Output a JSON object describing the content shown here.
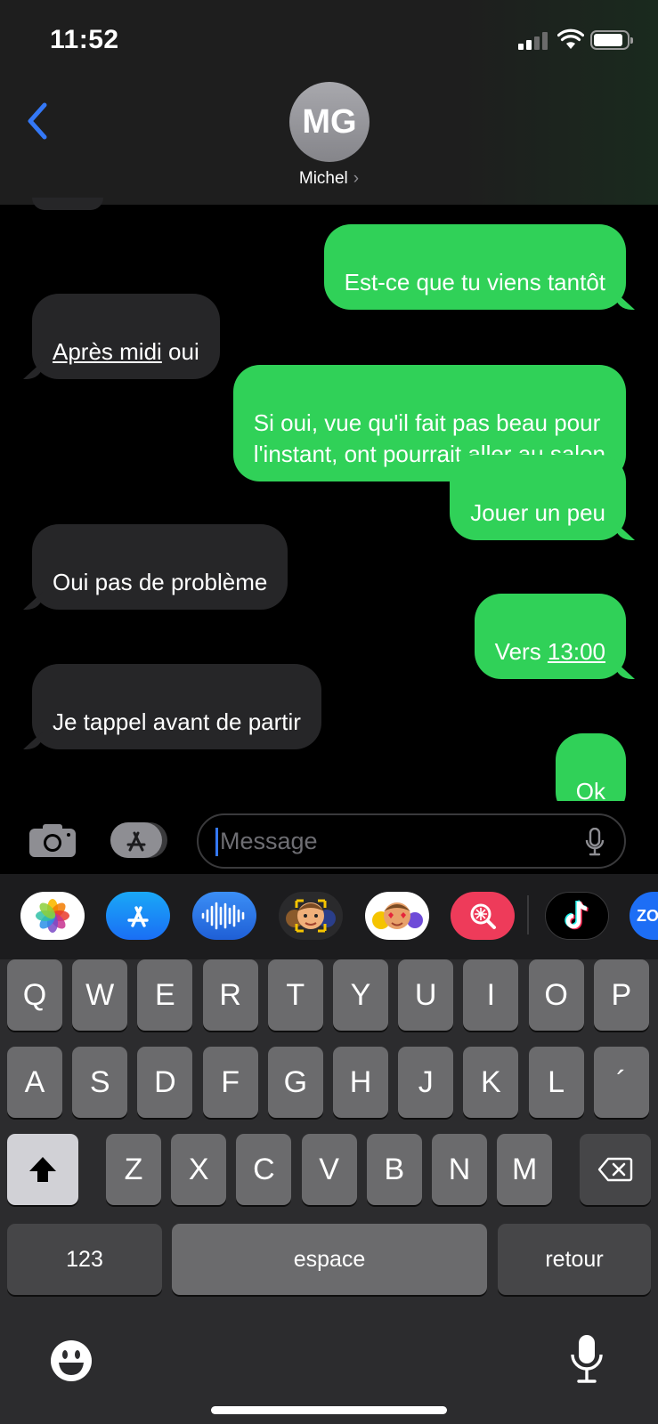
{
  "status_bar": {
    "time": "11:52",
    "icons": [
      "signal-icon",
      "wifi-icon",
      "battery-icon"
    ]
  },
  "header": {
    "avatar_initials": "MG",
    "contact_name": "Michel"
  },
  "messages": [
    {
      "direction": "sent",
      "text": "Est-ce que tu viens tantôt"
    },
    {
      "direction": "received",
      "text_underlined": "Après midi",
      "text_rest": " oui"
    },
    {
      "direction": "sent",
      "text": "Si oui, vue qu'il fait pas beau pour\nl'instant, ont pourrait aller au salon"
    },
    {
      "direction": "sent",
      "text": "Jouer un peu"
    },
    {
      "direction": "received",
      "text": "Oui pas de problème"
    },
    {
      "direction": "sent",
      "text_prefix": "Vers ",
      "text_underlined": "13:00"
    },
    {
      "direction": "received",
      "text": "Je tappel avant de partir"
    },
    {
      "direction": "sent",
      "text": "Ok"
    }
  ],
  "input": {
    "placeholder": "Message",
    "value": ""
  },
  "app_drawer": [
    "photos-icon",
    "app-store-icon",
    "audio-message-icon",
    "memoji-icon",
    "memoji-stickers-icon",
    "search-images-icon",
    "tiktok-icon",
    "zoom-icon"
  ],
  "app_drawer_partial_label": "ZO",
  "keyboard": {
    "row1": [
      "Q",
      "W",
      "E",
      "R",
      "T",
      "Y",
      "U",
      "I",
      "O",
      "P"
    ],
    "row2": [
      "A",
      "S",
      "D",
      "F",
      "G",
      "H",
      "J",
      "K",
      "L",
      "´"
    ],
    "row3": [
      "Z",
      "X",
      "C",
      "V",
      "B",
      "N",
      "M"
    ],
    "numbers_label": "123",
    "space_label": "espace",
    "return_label": "retour"
  },
  "colors": {
    "sent_bubble": "#30d158",
    "received_bubble": "#262628",
    "accent": "#3478f6"
  }
}
